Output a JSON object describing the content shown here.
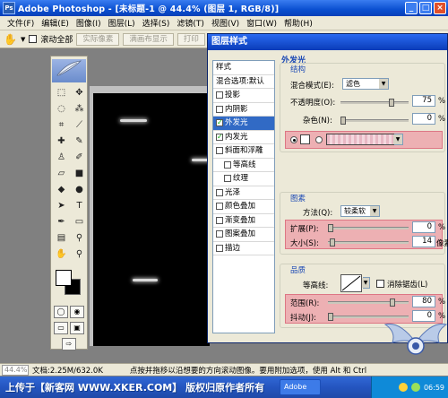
{
  "titlebar": {
    "app_icon": "Ps",
    "title": "Adobe Photoshop - [未标题-1 @ 44.4% (图层 1, RGB/8)]",
    "buttons": [
      "_",
      "□",
      "×"
    ]
  },
  "menu": [
    "文件(F)",
    "编辑(E)",
    "图像(I)",
    "图层(L)",
    "选择(S)",
    "滤镜(T)",
    "视图(V)",
    "窗口(W)",
    "帮助(H)"
  ],
  "options": {
    "scroll_all_label": "滚动全部",
    "btn_actual_pixels": "实际像素",
    "btn_fit_screen": "满画布显示",
    "btn_print_size": "打印"
  },
  "status": {
    "zoom": "44.4%",
    "doc_info": "文档:2.25M/632.0K",
    "hint": "点按并拖移以沿想要的方向滚动图像。要用附加选项，使用 Alt 和 Ctrl"
  },
  "taskbar": {
    "banner": "上传于【新客网 WWW.XKER.COM】 版权归原作者所有",
    "task_label": "Adobe",
    "clock": "06:59"
  },
  "dialog": {
    "title": "图层样式",
    "styles_list": [
      {
        "label": "样式",
        "checkbox": false,
        "checked": false,
        "selected": false
      },
      {
        "label": "混合选项:默认",
        "checkbox": false,
        "checked": false,
        "selected": false
      },
      {
        "label": "投影",
        "checkbox": true,
        "checked": false,
        "selected": false
      },
      {
        "label": "内阴影",
        "checkbox": true,
        "checked": false,
        "selected": false
      },
      {
        "label": "外发光",
        "checkbox": true,
        "checked": true,
        "selected": true
      },
      {
        "label": "内发光",
        "checkbox": true,
        "checked": true,
        "selected": false
      },
      {
        "label": "斜面和浮雕",
        "checkbox": true,
        "checked": false,
        "selected": false
      },
      {
        "label": "等高线",
        "checkbox": true,
        "checked": false,
        "selected": false,
        "indent": true
      },
      {
        "label": "纹理",
        "checkbox": true,
        "checked": false,
        "selected": false,
        "indent": true
      },
      {
        "label": "光泽",
        "checkbox": true,
        "checked": false,
        "selected": false
      },
      {
        "label": "颜色叠加",
        "checkbox": true,
        "checked": false,
        "selected": false
      },
      {
        "label": "渐变叠加",
        "checkbox": true,
        "checked": false,
        "selected": false
      },
      {
        "label": "图案叠加",
        "checkbox": true,
        "checked": false,
        "selected": false
      },
      {
        "label": "描边",
        "checkbox": true,
        "checked": false,
        "selected": false
      }
    ],
    "outer_glow": {
      "title": "外发光",
      "structure": {
        "title": "结构",
        "blend_mode_label": "混合模式(E):",
        "blend_mode_value": "滤色",
        "opacity_label": "不透明度(O):",
        "opacity_value": "75",
        "opacity_fraction": 0.75,
        "noise_label": "杂色(N):",
        "noise_value": "0",
        "noise_fraction": 0.0,
        "unit_percent": "%"
      },
      "elements": {
        "title": "图素",
        "technique_label": "方法(Q):",
        "technique_value": "较柔软",
        "spread_label": "扩展(P):",
        "spread_value": "0",
        "spread_fraction": 0.0,
        "size_label": "大小(S):",
        "size_value": "14",
        "size_fraction": 0.055,
        "unit_pixels": "像素"
      },
      "quality": {
        "title": "品质",
        "contour_label": "等高线:",
        "anti_alias_label": "消除锯齿(L)",
        "range_label": "范围(R):",
        "range_value": "80",
        "range_fraction": 0.8,
        "jitter_label": "抖动(J):",
        "jitter_value": "0",
        "jitter_fraction": 0.0
      }
    }
  },
  "colors": {
    "highlight": "#ee8296",
    "selection": "#316ac5",
    "title_blue": "#0a4fd0",
    "glow_color": "#f4d8de"
  }
}
